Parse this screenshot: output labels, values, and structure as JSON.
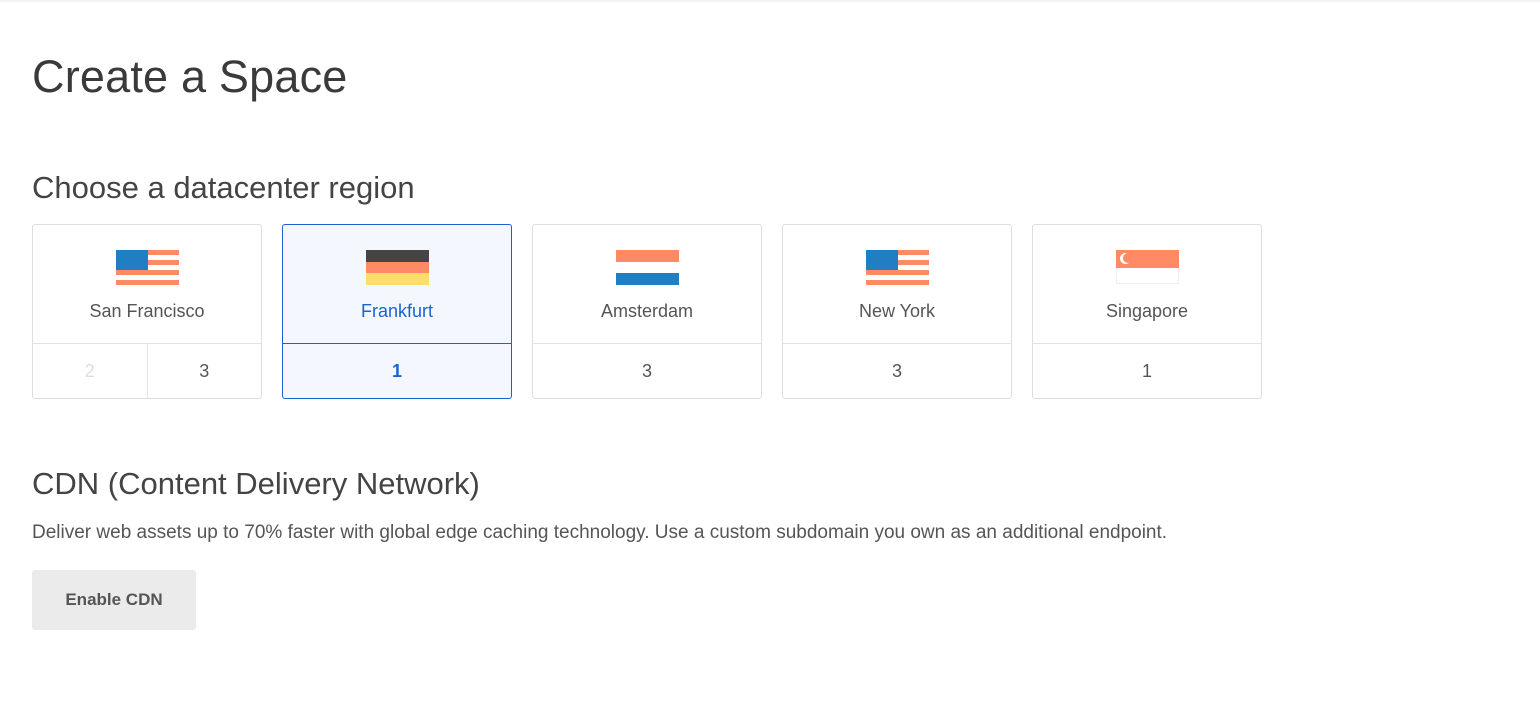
{
  "page": {
    "title": "Create a Space"
  },
  "region_section": {
    "title": "Choose a datacenter region",
    "regions": [
      {
        "name": "San Francisco",
        "flag": "us-flag-icon",
        "datacenters": [
          {
            "label": "2",
            "available": false
          },
          {
            "label": "3",
            "available": true
          }
        ],
        "selected": false
      },
      {
        "name": "Frankfurt",
        "flag": "germany-flag-icon",
        "datacenters": [
          {
            "label": "1",
            "available": true
          }
        ],
        "selected": true
      },
      {
        "name": "Amsterdam",
        "flag": "netherlands-flag-icon",
        "datacenters": [
          {
            "label": "3",
            "available": true
          }
        ],
        "selected": false
      },
      {
        "name": "New York",
        "flag": "us-flag-icon",
        "datacenters": [
          {
            "label": "3",
            "available": true
          }
        ],
        "selected": false
      },
      {
        "name": "Singapore",
        "flag": "singapore-flag-icon",
        "datacenters": [
          {
            "label": "1",
            "available": true
          }
        ],
        "selected": false
      }
    ]
  },
  "cdn_section": {
    "title": "CDN (Content Delivery Network)",
    "description": "Deliver web assets up to 70% faster with global edge caching technology. Use a custom subdomain you own as an additional endpoint.",
    "button_label": "Enable CDN"
  },
  "colors": {
    "accent": "#1b62d1",
    "flag_red": "#ff8a65",
    "flag_blue": "#1f7fc2",
    "flag_black": "#444444",
    "flag_gold": "#ffdd6b",
    "button_bg": "#ebebeb"
  }
}
